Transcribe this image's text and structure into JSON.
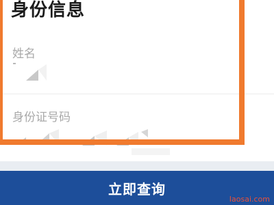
{
  "form": {
    "section_title": "身份信息",
    "name_label": "姓名",
    "id_label": "身份证号码"
  },
  "action": {
    "submit_label": "立即查询"
  },
  "watermark": "Iaosai.com",
  "colors": {
    "highlight": "#f07a2e",
    "primary_bar": "#1d4e9a",
    "label": "#a9a9a9"
  }
}
